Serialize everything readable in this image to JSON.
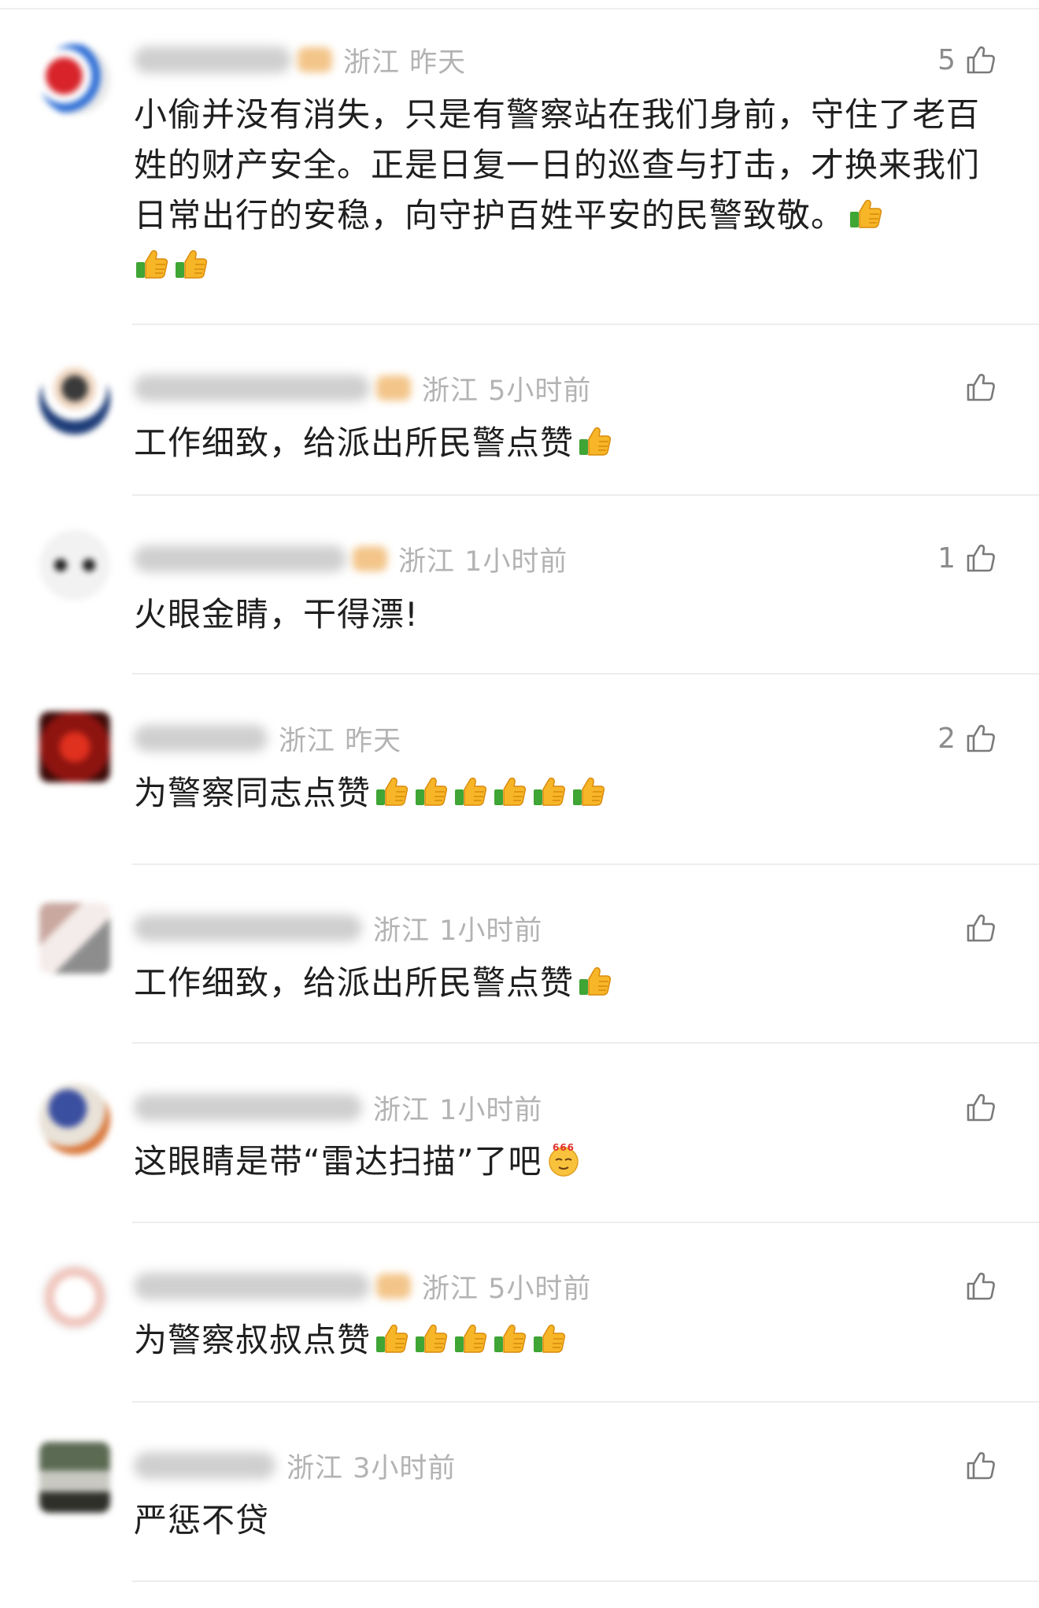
{
  "comments": [
    {
      "location": "浙江",
      "time": "昨天",
      "likes": "5",
      "text": "小偷并没有消失，只是有警察站在我们身前，守住了老百姓的财产安全。正是日复一日的巡查与打击，才换来我们日常出行的安稳，向守护百姓平安的民警致敬。",
      "emojis": 3
    },
    {
      "location": "浙江",
      "time": "5小时前",
      "likes": "",
      "text": "工作细致，给派出所民警点赞",
      "emojis": 1
    },
    {
      "location": "浙江",
      "time": "1小时前",
      "likes": "1",
      "text": "火眼金睛，干得漂!",
      "emojis": 0
    },
    {
      "location": "浙江",
      "time": "昨天",
      "likes": "2",
      "text": "为警察同志点赞",
      "emojis": 6
    },
    {
      "location": "浙江",
      "time": "1小时前",
      "likes": "",
      "text": "工作细致，给派出所民警点赞",
      "emojis": 1
    },
    {
      "location": "浙江",
      "time": "1小时前",
      "likes": "",
      "text": "这眼睛是带“雷达扫描”了吧",
      "emojis": 0,
      "special_emoji": "666"
    },
    {
      "location": "浙江",
      "time": "5小时前",
      "likes": "",
      "text": "为警察叔叔点赞",
      "emojis": 5
    },
    {
      "location": "浙江",
      "time": "3小时前",
      "likes": "",
      "text": "严惩不贷",
      "emojis": 0
    }
  ],
  "icons": {
    "like": "thumbs-up-outline-icon",
    "emoji": "thumbs-up-emoji-icon",
    "special": "666-emoji-icon"
  },
  "colors": {
    "text": "#1f1f1f",
    "meta": "#b3b3b3",
    "count": "#8c8c8c",
    "divider": "#ededed"
  }
}
